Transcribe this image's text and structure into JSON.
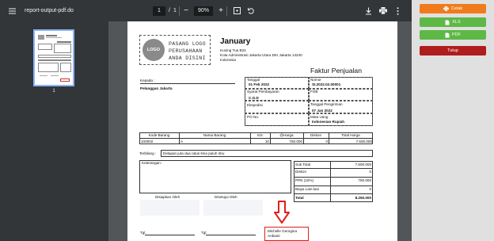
{
  "toolbar": {
    "filename": "report-output-pdf.do",
    "page_current": "1",
    "page_separator": "/",
    "page_total": "1",
    "zoom": "90%"
  },
  "sidebar": {
    "thumb_page_number": "1"
  },
  "doc": {
    "logo_text": "LOGO",
    "logo_placeholder": "PASANG LOGO PERUSAHAAN ANDA DISINI",
    "company_name": "January",
    "address_1": "Kuning Tua B22",
    "address_2": "Kota Administrasi Jakarta Utara DKI Jakarta 14240",
    "address_3": "Indonesia",
    "title": "Faktur Penjualan",
    "to_label": "Kepada :",
    "to_value": "Pelanggan Jakarta",
    "info": {
      "tanggal_label": "Tanggal",
      "tanggal_value": "01 Feb 2022",
      "nomor_label": "Nomor",
      "nomor_value": "SI.2022.02.00001",
      "syarat_label": "Syarat Pembayaran",
      "syarat_value": "C.O.D",
      "fob_label": "FOB",
      "ekspedisi_label": "Ekspedisi",
      "kirim_label": "Tanggal Pengiriman",
      "kirim_value": "07 Jan 2022",
      "po_label": "PO No.",
      "mata_uang_label": "Mata Uang",
      "mata_uang_value": "Indonesian Rupiah"
    },
    "items": {
      "headers": [
        "Kode Barang",
        "Nama Barang",
        "Kts",
        "@Harga",
        "Diskon",
        "Total Harga"
      ],
      "rows": [
        [
          "100002",
          "A",
          "10",
          "750.000",
          "0",
          "7.500.000"
        ]
      ]
    },
    "terbilang_label": "Terbilang :",
    "terbilang_value": "Delapan juta dua ratus lima puluh ribu",
    "keterangan_label": "Keterangan :",
    "totals": {
      "sub_total_label": "Sub Total",
      "sub_total_value": "7.500.000",
      "diskon_label": "Diskon",
      "diskon_value": "0",
      "ppn_label": "PPN (10%)",
      "ppn_value": "750.000",
      "biaya_label": "Biaya Lain-lain",
      "biaya_value": "0",
      "total_label": "Total",
      "total_value": "8.250.000"
    },
    "disiapkan_label": "Disiapkan Oleh",
    "disetujui_label": "Disetujui Oleh",
    "tgl_label_1": "Tgl.",
    "tgl_label_2": "Tgl.",
    "signer_line_1": "Michelle Georgina",
    "signer_line_2": "Ardianti"
  },
  "actions": {
    "cetak": "Cetak",
    "xls": "XLS",
    "pdf": "PDF",
    "tutup": "Tutup"
  },
  "colors": {
    "cetak": "#f07b1c",
    "xls": "#5eb846",
    "pdf": "#5eb846",
    "tutup": "#b01d1d",
    "arrow": "#e0201a"
  }
}
